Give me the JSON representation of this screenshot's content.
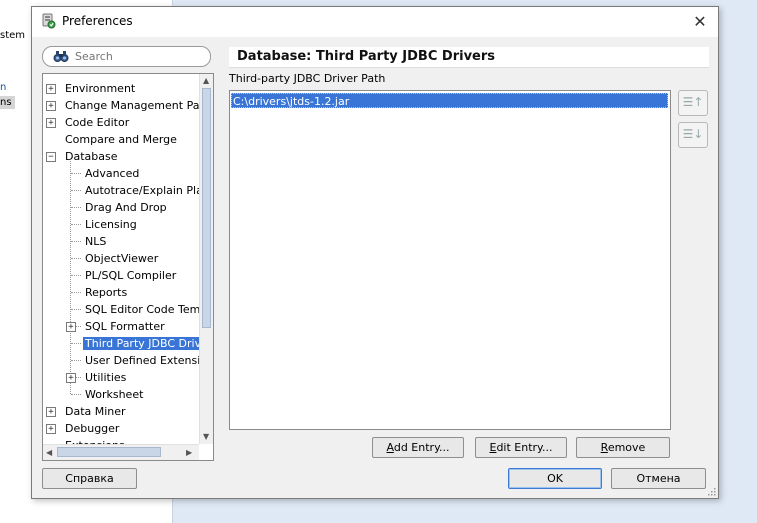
{
  "background": {
    "text1": "stem",
    "text2": "n",
    "text3": "ns"
  },
  "dialog": {
    "title": "Preferences",
    "close_glyph": "✕"
  },
  "search": {
    "placeholder": "Search",
    "icon": "binoculars-icon"
  },
  "tree": {
    "items": [
      {
        "label": "Environment",
        "level": 0,
        "expandable": true,
        "expanded": false
      },
      {
        "label": "Change Management Param",
        "level": 0,
        "expandable": true,
        "expanded": false
      },
      {
        "label": "Code Editor",
        "level": 0,
        "expandable": true,
        "expanded": false
      },
      {
        "label": "Compare and Merge",
        "level": 0,
        "expandable": false
      },
      {
        "label": "Database",
        "level": 0,
        "expandable": true,
        "expanded": true
      },
      {
        "label": "Advanced",
        "level": 1,
        "expandable": false
      },
      {
        "label": "Autotrace/Explain Plan",
        "level": 1,
        "expandable": false
      },
      {
        "label": "Drag And Drop",
        "level": 1,
        "expandable": false
      },
      {
        "label": "Licensing",
        "level": 1,
        "expandable": false
      },
      {
        "label": "NLS",
        "level": 1,
        "expandable": false
      },
      {
        "label": "ObjectViewer",
        "level": 1,
        "expandable": false
      },
      {
        "label": "PL/SQL Compiler",
        "level": 1,
        "expandable": false
      },
      {
        "label": "Reports",
        "level": 1,
        "expandable": false
      },
      {
        "label": "SQL Editor Code Templa",
        "level": 1,
        "expandable": false
      },
      {
        "label": "SQL Formatter",
        "level": 1,
        "expandable": true,
        "expanded": false
      },
      {
        "label": "Third Party JDBC Driver",
        "level": 1,
        "expandable": false,
        "selected": true
      },
      {
        "label": "User Defined Extension",
        "level": 1,
        "expandable": false
      },
      {
        "label": "Utilities",
        "level": 1,
        "expandable": true,
        "expanded": false
      },
      {
        "label": "Worksheet",
        "level": 1,
        "expandable": false
      },
      {
        "label": "Data Miner",
        "level": 0,
        "expandable": true,
        "expanded": false
      },
      {
        "label": "Debugger",
        "level": 0,
        "expandable": true,
        "expanded": false
      },
      {
        "label": "Extensions",
        "level": 0,
        "expandable": false
      }
    ]
  },
  "main": {
    "title": "Database: Third Party JDBC Drivers",
    "path_label": "Third-party JDBC Driver Path",
    "drivers": [
      "C:\\drivers\\jtds-1.2.jar"
    ]
  },
  "buttons": {
    "add_entry_u": "A",
    "add_entry_rest": "dd Entry...",
    "edit_entry_u": "E",
    "edit_entry_rest": "dit Entry...",
    "remove_u": "R",
    "remove_rest": "emove",
    "help": "Справка",
    "ok": "OK",
    "cancel": "Отмена"
  },
  "colors": {
    "selection": "#3875d7",
    "dialog_bg": "#f0f0f0"
  }
}
